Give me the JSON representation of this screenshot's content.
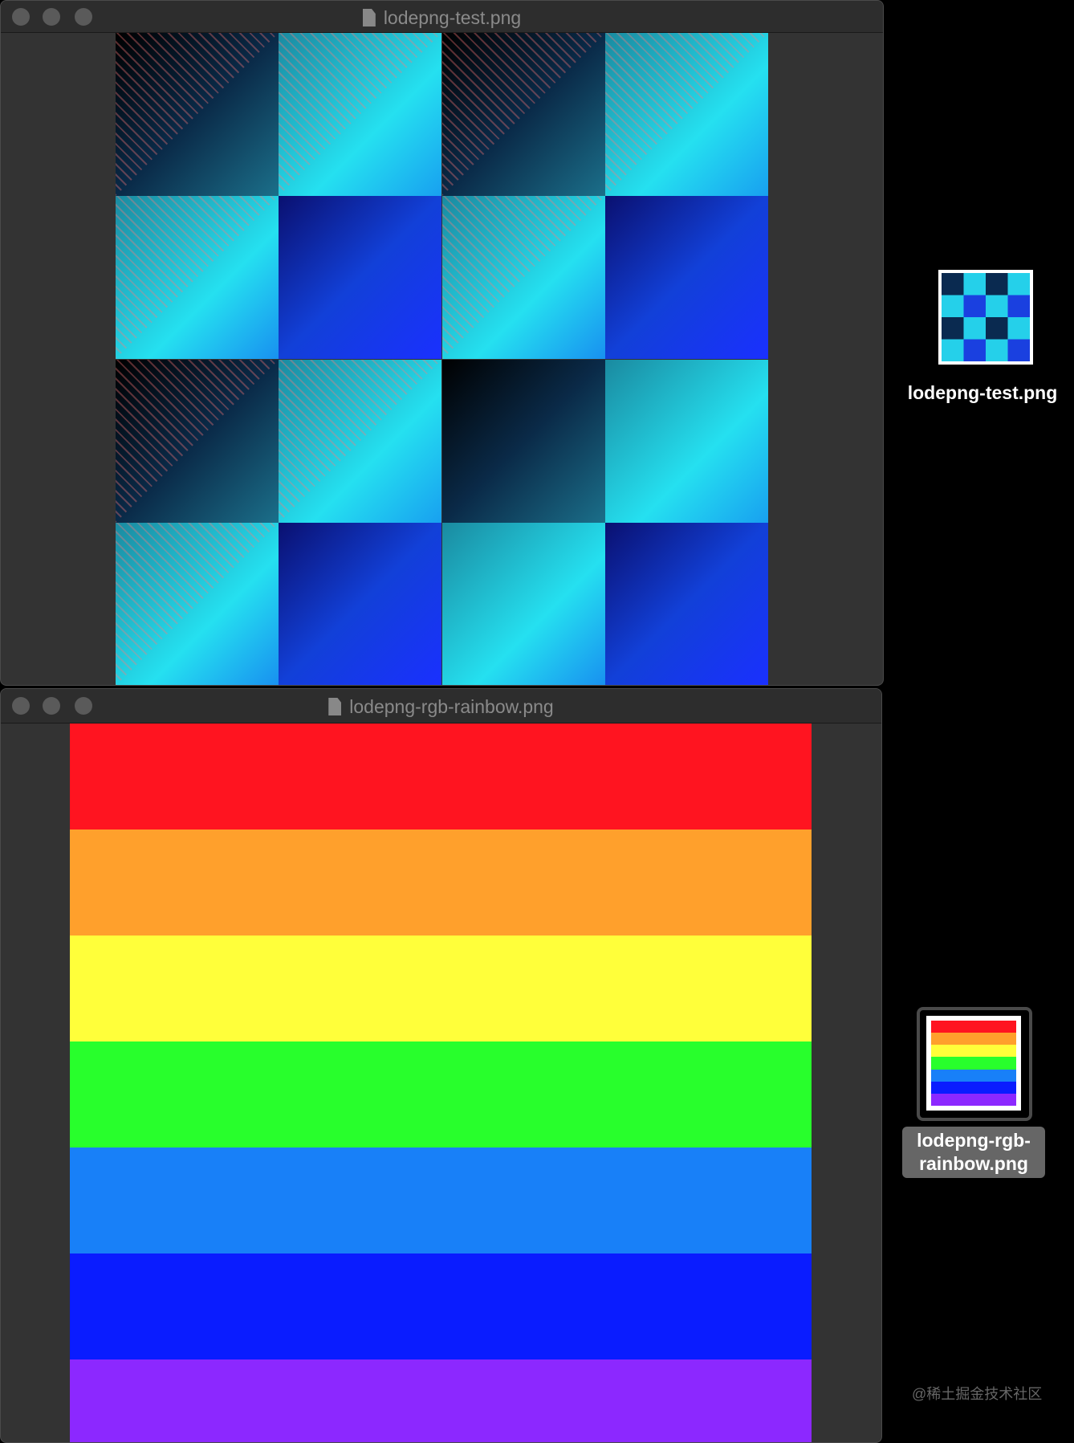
{
  "windows": [
    {
      "title": "lodepng-test.png"
    },
    {
      "title": "lodepng-rgb-rainbow.png",
      "stripes": [
        "#ff1420",
        "#ffa02c",
        "#ffff3a",
        "#28ff2c",
        "#1880f8",
        "#0a1cff",
        "#8c28ff"
      ]
    }
  ],
  "desktop": {
    "icons": [
      {
        "label": "lodepng-test.png"
      },
      {
        "label": "lodepng-rgb-rainbow.png",
        "selected": true
      }
    ],
    "watermark": "@稀土掘金技术社区"
  }
}
